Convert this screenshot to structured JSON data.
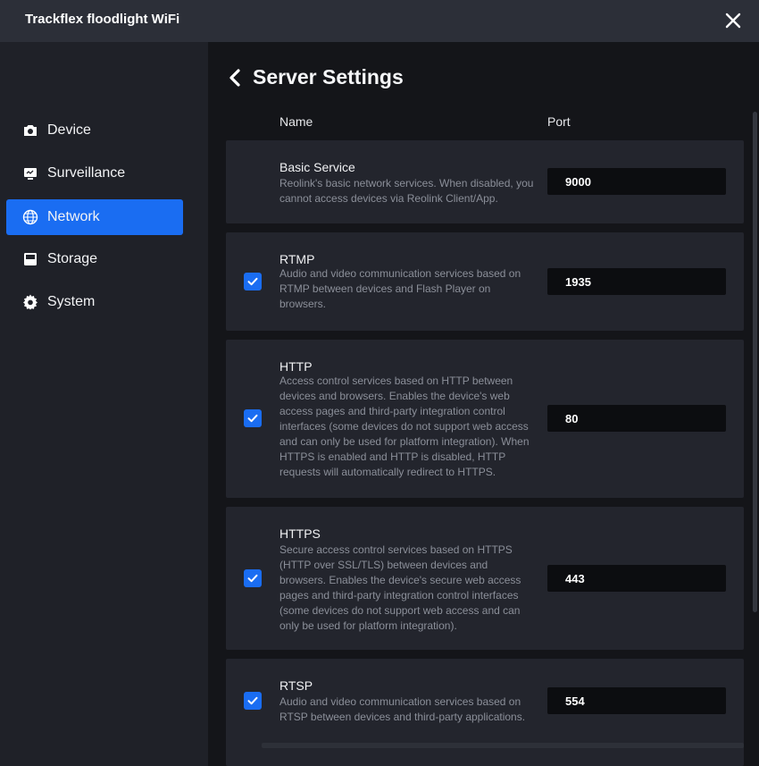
{
  "window": {
    "title": "Trackflex floodlight WiFi"
  },
  "sidebar": {
    "items": [
      {
        "label": "Device",
        "icon": "camera-icon",
        "active": false
      },
      {
        "label": "Surveillance",
        "icon": "monitor-icon",
        "active": false
      },
      {
        "label": "Network",
        "icon": "globe-icon",
        "active": true
      },
      {
        "label": "Storage",
        "icon": "storage-icon",
        "active": false
      },
      {
        "label": "System",
        "icon": "gear-icon",
        "active": false
      }
    ]
  },
  "main": {
    "title": "Server Settings",
    "columns": {
      "name": "Name",
      "port": "Port"
    },
    "services": [
      {
        "name": "Basic Service",
        "description": "Reolink's basic network services. When disabled, you cannot access devices via Reolink Client/App.",
        "port": "9000",
        "checkbox": false
      },
      {
        "name": "RTMP",
        "description": "Audio and video communication services based on RTMP between devices and Flash Player on browsers.",
        "port": "1935",
        "checkbox": true
      },
      {
        "name": "HTTP",
        "description": "Access control services based on HTTP between devices and browsers. Enables the device's web access pages and third-party integration control interfaces (some devices do not support web access and can only be used for platform integration). When HTTPS is enabled and HTTP is disabled, HTTP requests will automatically redirect to HTTPS.",
        "port": "80",
        "checkbox": true
      },
      {
        "name": "HTTPS",
        "description": "Secure access control services based on HTTPS (HTTP over SSL/TLS) between devices and browsers. Enables the device's secure web access pages and third-party integration control interfaces (some devices do not support web access and can only be used for platform integration).",
        "port": "443",
        "checkbox": true
      },
      {
        "name": "RTSP",
        "description": "Audio and video communication services based on RTSP between devices and third-party applications.",
        "port": "554",
        "checkbox": true
      }
    ]
  },
  "colors": {
    "accent": "#1a6df2",
    "background": "#141519",
    "card": "#23252d",
    "sidebar": "#1f2128",
    "titlebar": "#2c2f38"
  }
}
